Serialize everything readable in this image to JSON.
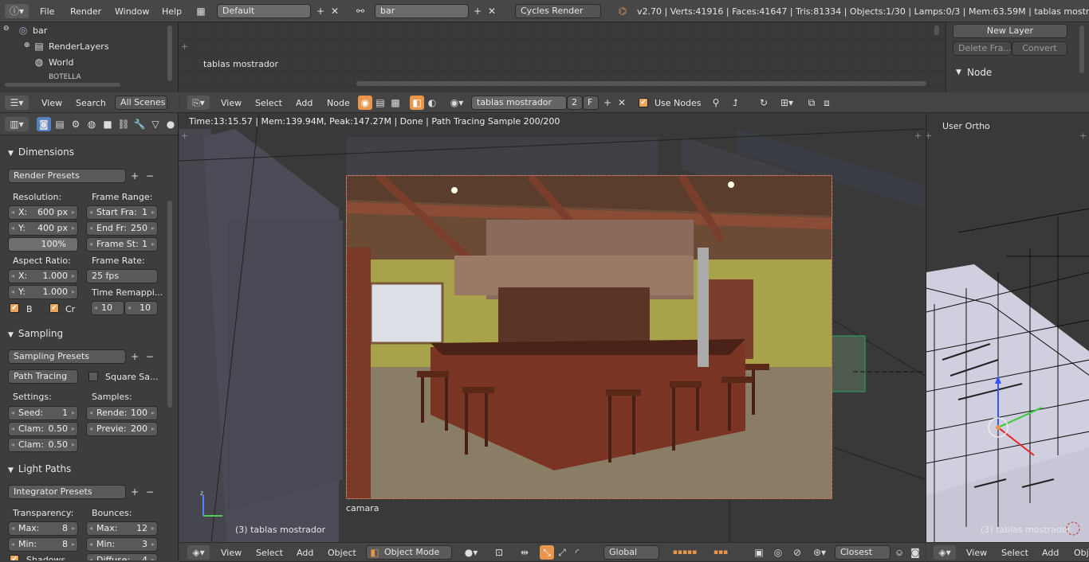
{
  "info_header": {
    "render_engine": "Cycles Render",
    "stats": "v2.70 | Verts:41916 | Faces:41647 | Tris:81334 | Objects:1/30 | Lamps:0/3 | Mem:63.59M | tablas mostrador",
    "menus": [
      "File",
      "Render",
      "Window",
      "Help"
    ],
    "screen_layout": "Default",
    "scene": "bar"
  },
  "outliner": {
    "items": [
      "bar",
      "RenderLayers",
      "World",
      "BOTELLA"
    ],
    "header_menus": [
      "View",
      "Search",
      "All Scenes"
    ]
  },
  "top_view": {
    "label": "tablas mostrador"
  },
  "node_panel": {
    "new_layer": "New Layer",
    "delete_frame": "Delete Fra...",
    "convert": "Convert",
    "node_header": "Node"
  },
  "node_header": {
    "menus": [
      "View",
      "Select",
      "Add",
      "Node"
    ],
    "material": "tablas mostrador",
    "users": "2",
    "fake": "F",
    "use_nodes": "Use Nodes"
  },
  "properties": {
    "dimensions": {
      "title": "Dimensions",
      "presets": "Render Presets",
      "resolution": "Resolution:",
      "res_x_label": "X:",
      "res_x": "600 px",
      "res_y_label": "Y:",
      "res_y": "400 px",
      "percent": "100%",
      "frame_range": "Frame Range:",
      "start_label": "Start Fra:",
      "start": "1",
      "end_label": "End Fr:",
      "end": "250",
      "step_label": "Frame St:",
      "step": "1",
      "aspect": "Aspect Ratio:",
      "asp_x_label": "X:",
      "asp_x": "1.000",
      "asp_y_label": "Y:",
      "asp_y": "1.000",
      "frame_rate": "Frame Rate:",
      "fps": "25 fps",
      "time_remap": "Time Remappi...",
      "remap_old": "10",
      "remap_new": "10",
      "border": "B",
      "crop": "Cr"
    },
    "sampling": {
      "title": "Sampling",
      "presets": "Sampling Presets",
      "method": "Path Tracing",
      "square": "Square Sa...",
      "settings": "Settings:",
      "seed_label": "Seed:",
      "seed": "1",
      "clamp1_label": "Clam:",
      "clamp1": "0.50",
      "clamp2_label": "Clam:",
      "clamp2": "0.50",
      "samples": "Samples:",
      "render_label": "Rende:",
      "render": "100",
      "preview_label": "Previe:",
      "preview": "200"
    },
    "light_paths": {
      "title": "Light Paths",
      "presets": "Integrator Presets",
      "transparency": "Transparency:",
      "t_max_label": "Max:",
      "t_max": "8",
      "t_min_label": "Min:",
      "t_min": "8",
      "bounces": "Bounces:",
      "b_max_label": "Max:",
      "b_max": "12",
      "b_min_label": "Min:",
      "b_min": "3",
      "shadows": "Shadows",
      "diffuse_label": "Diffuse:",
      "diffuse": "4"
    }
  },
  "viewport": {
    "render_info": "Time:13:15.57 | Mem:139.94M, Peak:147.27M | Done | Path Tracing Sample 200/200",
    "camera_label": "camara",
    "object_label": "(3) tablas mostrador",
    "menus": [
      "View",
      "Select",
      "Add",
      "Object"
    ],
    "mode": "Object Mode",
    "orientation": "Global",
    "snap": "Closest"
  },
  "right_view": {
    "label": "User Ortho",
    "object_label": "(3) tablas mostrador",
    "menus": [
      "View",
      "Select",
      "Add",
      "Obj"
    ]
  },
  "colors": {
    "accent": "#e9964a",
    "selected": "#5680c2",
    "bg": "#3d3d3d"
  }
}
